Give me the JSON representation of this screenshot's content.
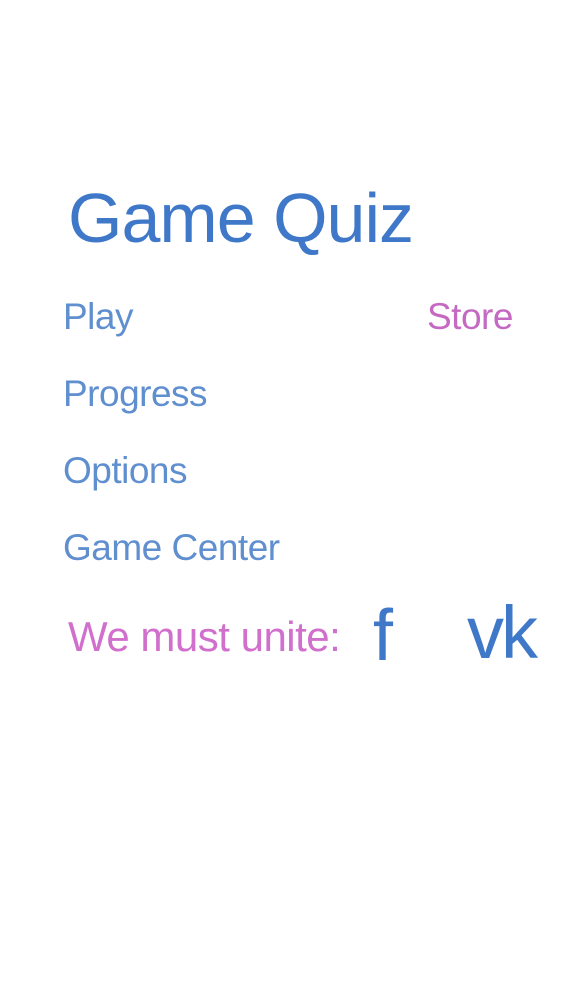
{
  "app": {
    "title": "Game Quiz"
  },
  "menu": {
    "items": [
      {
        "id": "play",
        "label": "Play"
      },
      {
        "id": "progress",
        "label": "Progress"
      },
      {
        "id": "options",
        "label": "Options"
      },
      {
        "id": "game_center",
        "label": "Game Center"
      }
    ],
    "store_label": "Store"
  },
  "social": {
    "label": "We must unite:",
    "facebook": {
      "label": "f",
      "icon": "facebook-icon"
    },
    "vk": {
      "label": "vk",
      "icon": "vk-icon"
    }
  },
  "colors": {
    "primary_blue": "#3f78c8",
    "menu_blue": "#5f8fcf",
    "accent_pink": "#c56ac3",
    "background": "#ffffff"
  }
}
